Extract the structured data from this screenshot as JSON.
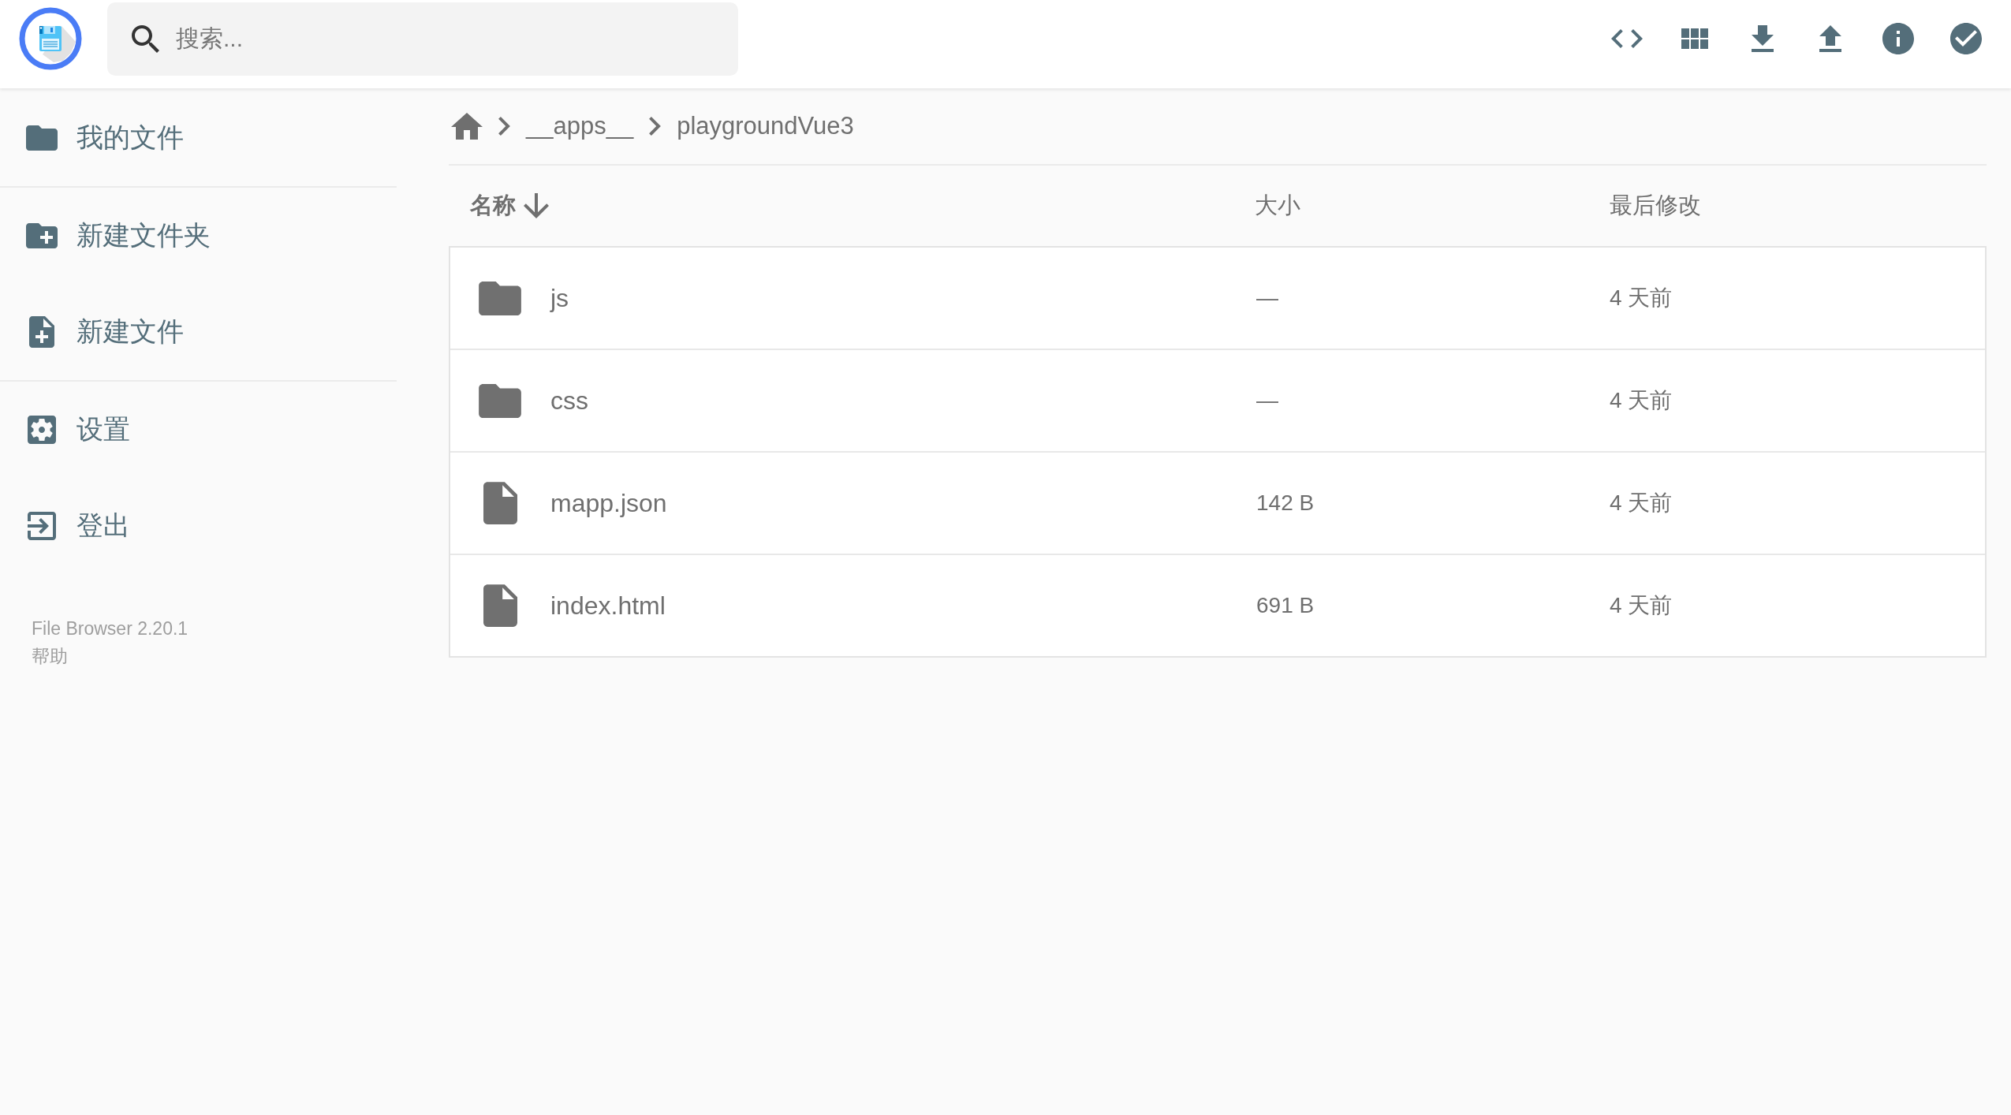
{
  "header": {
    "search": {
      "placeholder": "搜索..."
    }
  },
  "sidebar": {
    "groups": [
      [
        {
          "label": "我的文件"
        }
      ],
      [
        {
          "label": "新建文件夹"
        },
        {
          "label": "新建文件"
        }
      ],
      [
        {
          "label": "设置"
        },
        {
          "label": "登出"
        }
      ]
    ],
    "footer": {
      "version": "File Browser 2.20.1",
      "help": "帮助"
    }
  },
  "breadcrumb": [
    {
      "label": "__apps__"
    },
    {
      "label": "playgroundVue3"
    }
  ],
  "table": {
    "columns": [
      {
        "label": "名称",
        "sorted": true
      },
      {
        "label": "大小",
        "sorted": false
      },
      {
        "label": "最后修改",
        "sorted": false
      }
    ],
    "rows": [
      {
        "kind": "folder",
        "name": "js",
        "size": "—",
        "modified": "4 天前"
      },
      {
        "kind": "folder",
        "name": "css",
        "size": "—",
        "modified": "4 天前"
      },
      {
        "kind": "file",
        "name": "mapp.json",
        "size": "142 B",
        "modified": "4 天前"
      },
      {
        "kind": "file",
        "name": "index.html",
        "size": "691 B",
        "modified": "4 天前"
      }
    ]
  }
}
